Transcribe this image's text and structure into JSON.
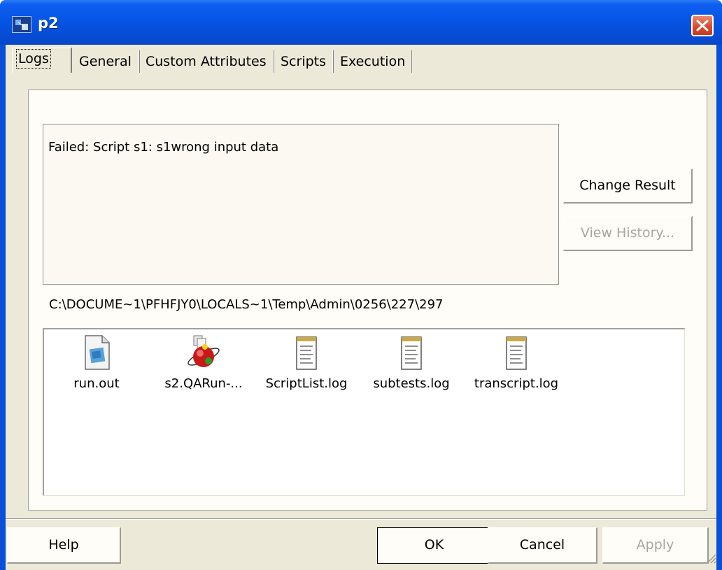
{
  "window": {
    "title": "p2"
  },
  "tabs": [
    {
      "label": "Logs"
    },
    {
      "label": "General"
    },
    {
      "label": "Custom Attributes"
    },
    {
      "label": "Scripts"
    },
    {
      "label": "Execution"
    }
  ],
  "message": "Failed: Script s1: s1wrong input data",
  "buttons": {
    "change_result": "Change Result",
    "view_history": "View History...",
    "help": "Help",
    "ok": "OK",
    "cancel": "Cancel",
    "apply": "Apply"
  },
  "path": "C:\\DOCUME~1\\PFHFJY0\\LOCALS~1\\Temp\\Admin\\0256\\227\\297",
  "files": [
    {
      "name": "run.out",
      "icon": "document-image-icon"
    },
    {
      "name": "s2.QARun-...",
      "icon": "qarun-script-icon"
    },
    {
      "name": "ScriptList.log",
      "icon": "notepad-log-icon"
    },
    {
      "name": "subtests.log",
      "icon": "notepad-log-icon"
    },
    {
      "name": "transcript.log",
      "icon": "notepad-log-icon"
    }
  ]
}
